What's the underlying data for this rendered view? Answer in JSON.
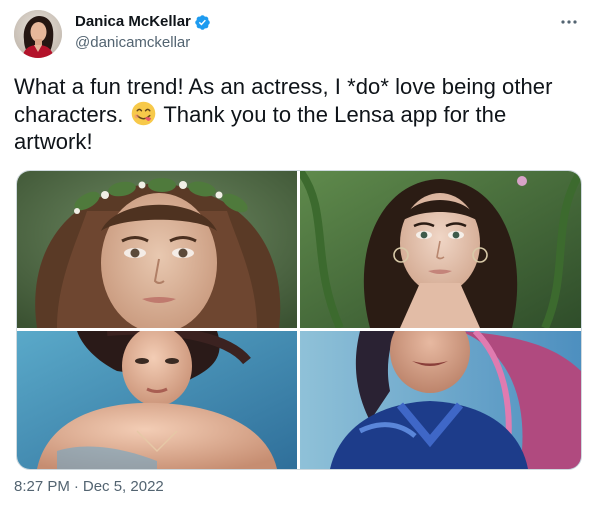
{
  "author": {
    "name": "Danica McKellar",
    "handle": "@danicamckellar",
    "verified": true,
    "avatar_icon": "profile-photo",
    "verified_icon": "verified-badge-icon"
  },
  "tweet": {
    "text_before_emoji": "What a fun trend! As an actress, I *do* love being other characters.",
    "emoji_icon": "face-savoring-food-emoji",
    "text_after_emoji": "Thank you to the Lensa app for the artwork!"
  },
  "media": {
    "images": [
      {
        "name": "portrait-floral-crown"
      },
      {
        "name": "portrait-forest-vines"
      },
      {
        "name": "portrait-blue-background"
      },
      {
        "name": "portrait-blue-suit-pink-hair"
      }
    ]
  },
  "meta": {
    "time": "8:27 PM",
    "separator": "·",
    "date": "Dec 5, 2022"
  },
  "menu": {
    "more_icon": "more-options-icon"
  },
  "colors": {
    "text": "#0f1419",
    "secondary": "#536471",
    "verified": "#1d9bf0",
    "border": "#cfd9de"
  }
}
